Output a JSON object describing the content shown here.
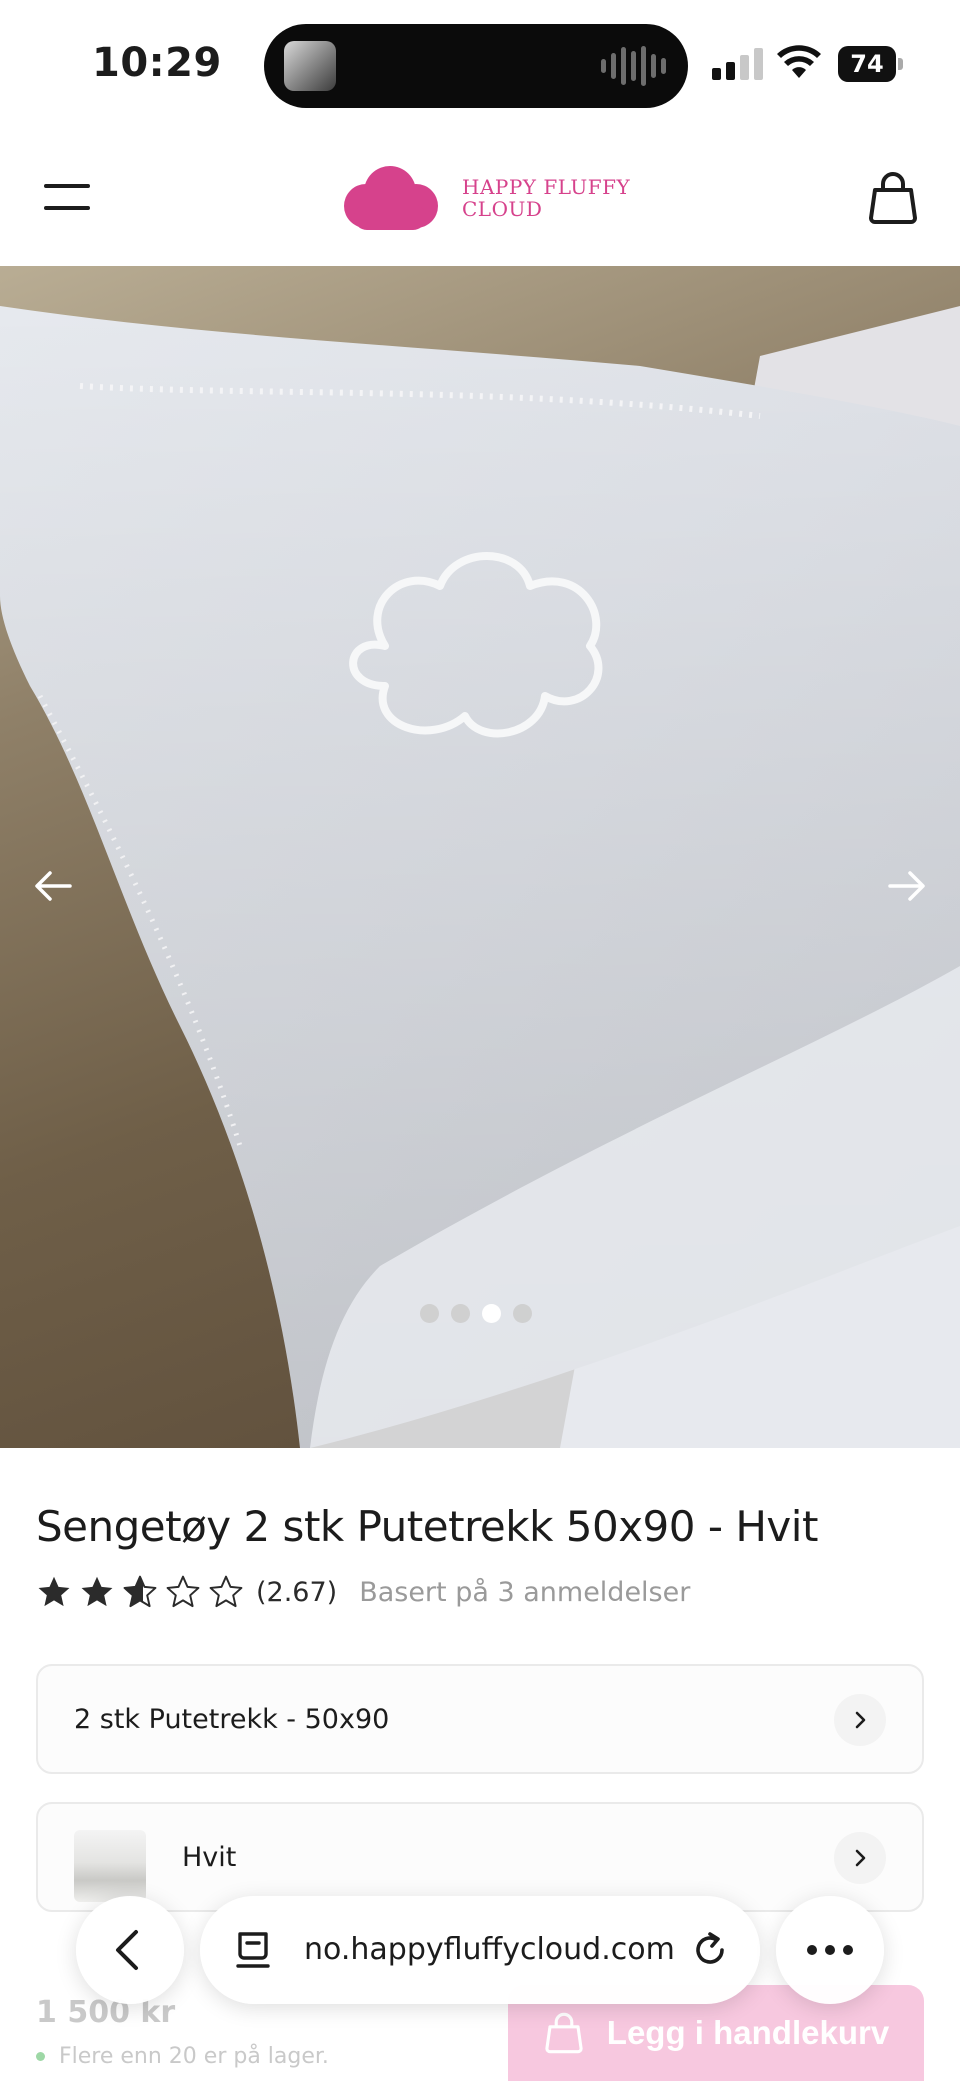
{
  "status_bar": {
    "time": "10:29",
    "battery": "74"
  },
  "header": {
    "logo_line1": "HAPPY FLUFFY",
    "logo_line2": "CLOUD",
    "brand_color": "#d6428c"
  },
  "gallery": {
    "slide_count": 4,
    "active_slide": 3
  },
  "product": {
    "title": "Sengetøy 2 stk Putetrekk 50x90 - Hvit",
    "rating": 2.67,
    "rating_display": "(2.67)",
    "review_text": "Basert på 3 anmeldelser",
    "size_option": "2 stk Putetrekk - 50x90",
    "color_option": "Hvit",
    "price": "1 500 kr",
    "stock": "Flere enn 20 er på lager.",
    "add_to_cart": "Legg i handlekurv"
  },
  "browser": {
    "url": "no.happyfluffycloud.com"
  }
}
